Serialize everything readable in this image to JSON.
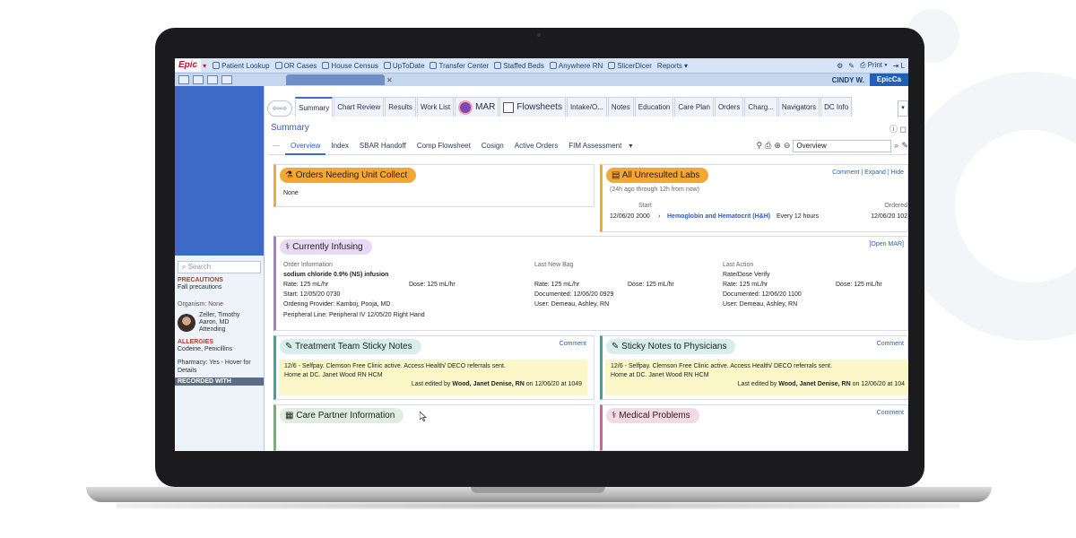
{
  "toolbar": {
    "logo": "Epic",
    "items": [
      "Patient Lookup",
      "OR Cases",
      "House Census",
      "UpToDate",
      "Transfer Center",
      "Staffed Beds",
      "Anywhere RN",
      "SlicerDicer",
      "Reports"
    ],
    "print": "Print"
  },
  "secondbar": {
    "user": "CINDY W.",
    "epicca": "EpicCa"
  },
  "sidebar": {
    "search_placeholder": "Search",
    "precautions_label": "PRECAUTIONS",
    "precautions_value": "Fall precautions",
    "organism": "Organism: None",
    "attending_name1": "Zeller, Timothy",
    "attending_name2": "Aaron, MD",
    "attending_role": "Attending",
    "allergies_label": "ALLERGIES",
    "allergies_value": "Codeine, Penicillins",
    "pharmacy": "Pharmacy: Yes - Hover for",
    "pharmacy2": "Details",
    "recorded": "RECORDED WITH"
  },
  "activity_tabs": [
    "Summary",
    "Chart Review",
    "Results",
    "Work List",
    "MAR",
    "Flowsheets",
    "Intake/O...",
    "Notes",
    "Education",
    "Care Plan",
    "Orders",
    "Charg...",
    "Navigators",
    "DC Info"
  ],
  "summary_title": "Summary",
  "subtabs": [
    "Overview",
    "Index",
    "SBAR Handoff",
    "Comp Flowsheet",
    "Cosign",
    "Active Orders",
    "FIM Assessment"
  ],
  "overview_field": "Overview",
  "orders_card": {
    "title": "Orders Needing Unit Collect",
    "value": "None"
  },
  "labs_card": {
    "title": "All Unresulted Labs",
    "links": "Comment | Expand | Hide",
    "range": "(24h ago through 12h from now)",
    "start_label": "Start",
    "ordered_label": "Ordered",
    "start_value": "12/06/20 2000",
    "lab_name": "Hemoglobin and Hematocrit (H&H)",
    "frequency": "Every 12 hours",
    "ordered_value": "12/06/20 102"
  },
  "infusing_card": {
    "title": "Currently Infusing",
    "open_link": "[Open MAR]",
    "order_info_label": "Order Information",
    "drug": "sodium chloride 0.9% (NS) infusion",
    "rate": "Rate: 125 mL/hr",
    "dose": "Dose: 125 mL/hr",
    "start": "Start: 12/05/20 0730",
    "provider": "Ordering Provider: Kamboj, Pooja, MD",
    "line": "Peripheral Line: Peripheral IV 12/05/20 Right Hand",
    "last_bag_label": "Last New Bag",
    "bag_rate": "Rate: 125 mL/hr",
    "bag_dose": "Dose: 125 mL/hr",
    "bag_doc": "Documented: 12/06/20 0929",
    "bag_user": "User: Demeau, Ashley, RN",
    "last_action_label": "Last Action",
    "action": "Rate/Dose Verify",
    "action_rate": "Rate: 125 mL/hr",
    "action_dose": "Dose: 125 mL/hr",
    "action_doc": "Documented: 12/06/20 1100",
    "action_user": "User: Demeau, Ashley, RN"
  },
  "team_notes": {
    "title": "Treatment Team Sticky Notes",
    "comment": "Comment",
    "line1": "12/6 - Selfpay.  Clemson Free Clinic active. Access Health/ DECO referrals sent.",
    "line2": "Home at DC.  Janet Wood RN HCM",
    "edited_prefix": "Last edited by",
    "edited_by": "Wood, Janet Denise, RN",
    "edited_suffix": "on 12/06/20 at 1049"
  },
  "physician_notes": {
    "title": "Sticky Notes to Physicians",
    "comment": "Comment",
    "line1": "12/6 - Selfpay.  Clemson Free Clinic active. Access Health/ DECO referrals sent.",
    "line2": "Home at DC.  Janet Wood RN HCM",
    "edited_prefix": "Last edited by",
    "edited_by": "Wood, Janet Denise, RN",
    "edited_suffix": "on 12/06/20 at 104"
  },
  "care_partner": {
    "title": "Care Partner Information"
  },
  "medical_problems": {
    "title": "Medical Problems",
    "comment": "Comment"
  }
}
